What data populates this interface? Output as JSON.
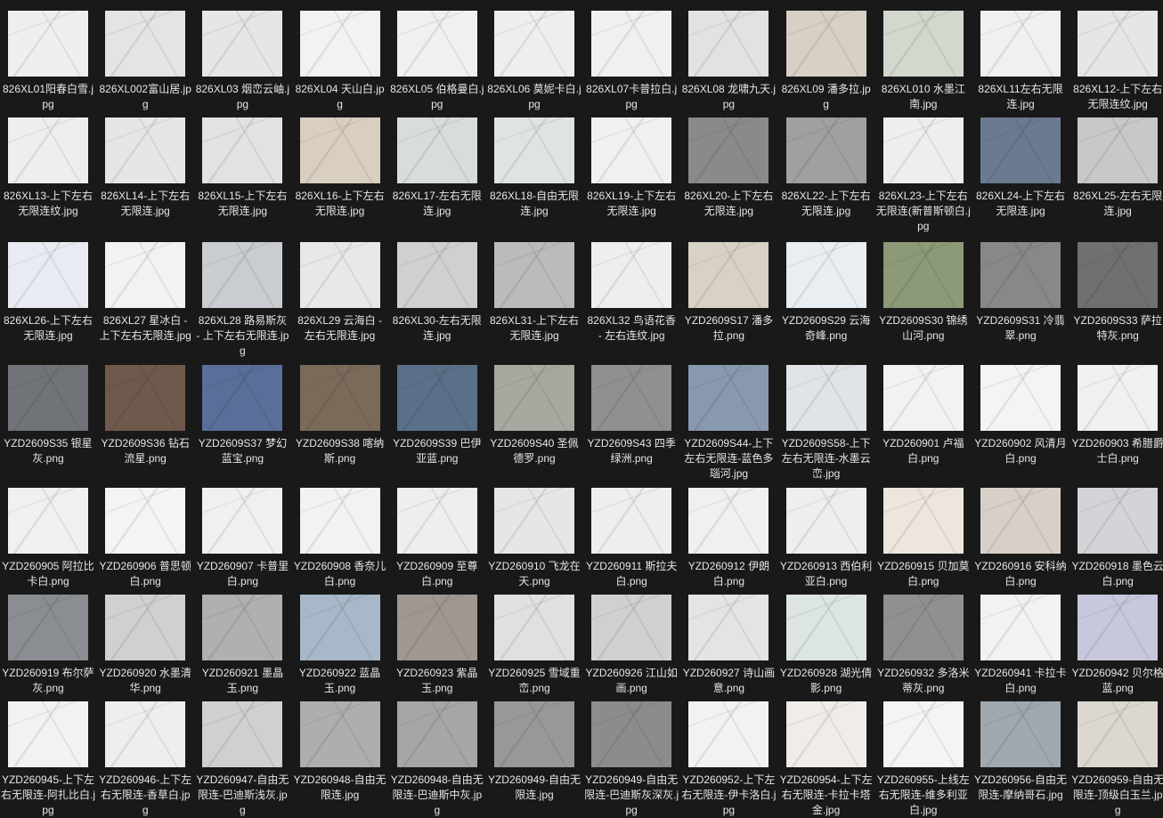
{
  "rows": [
    [
      {
        "name": "826XL01阳春白雪.jpg",
        "tone": "#efefef"
      },
      {
        "name": "826XL002富山居.jpg",
        "tone": "#e4e4e4"
      },
      {
        "name": "826XL03  烟峦云岫.jpg",
        "tone": "#e8e6e4"
      },
      {
        "name": "826XL04 天山白.jpg",
        "tone": "#f2f2f2"
      },
      {
        "name": "826XL05 伯格曼白.jpg",
        "tone": "#f0f0f0"
      },
      {
        "name": "826XL06 莫妮卡白.jpg",
        "tone": "#eeeeee"
      },
      {
        "name": "826XL07卡普拉白.jpg",
        "tone": "#f0f0f0"
      },
      {
        "name": "826XL08 龙啸九天.jpg",
        "tone": "#e2e2e2"
      },
      {
        "name": "826XL09 潘多拉.jpg",
        "tone": "#d8d0c4"
      },
      {
        "name": "826XL010 水墨江南.jpg",
        "tone": "#d2d8ce"
      },
      {
        "name": "826XL11左右无限连.jpg",
        "tone": "#f0f0f0"
      },
      {
        "name": "826XL12-上下左右无限连纹.jpg",
        "tone": "#e6e6e6"
      }
    ],
    [
      {
        "name": "826XL13-上下左右无限连纹.jpg",
        "tone": "#eeeeee"
      },
      {
        "name": "826XL14-上下左右无限连.jpg",
        "tone": "#e6e6e6"
      },
      {
        "name": "826XL15-上下左右无限连.jpg",
        "tone": "#e2e2e2"
      },
      {
        "name": "826XL16-上下左右无限连.jpg",
        "tone": "#d9cfc0"
      },
      {
        "name": "826XL17-左右无限连.jpg",
        "tone": "#d8dcdc"
      },
      {
        "name": "826XL18-自由无限连.jpg",
        "tone": "#dfe3e3"
      },
      {
        "name": "826XL19-上下左右无限连.jpg",
        "tone": "#f0f0f0"
      },
      {
        "name": "826XL20-上下左右无限连.jpg",
        "tone": "#8a8a8a"
      },
      {
        "name": "826XL22-上下左右无限连.jpg",
        "tone": "#a0a0a0"
      },
      {
        "name": "826XL23-上下左右无限连(新普斯顿白.jpg",
        "tone": "#eeeeee"
      },
      {
        "name": "826XL24-上下左右无限连.jpg",
        "tone": "#6a7a90"
      },
      {
        "name": "826XL25-左右无限连.jpg",
        "tone": "#c8c8c8"
      }
    ],
    [
      {
        "name": "826XL26-上下左右无限连.jpg",
        "tone": "#e8ecf2"
      },
      {
        "name": "826XL27 星冰白 - 上下左右无限连.jpg",
        "tone": "#f0f2f4"
      },
      {
        "name": "826XL28 路易斯灰 - 上下左右无限连.jpg",
        "tone": "#c9ccd0"
      },
      {
        "name": "826XL29 云海白 - 左右无限连.jpg",
        "tone": "#e8e8e8"
      },
      {
        "name": "826XL30-左右无限连.jpg",
        "tone": "#d0d0d0"
      },
      {
        "name": "826XL31-上下左右无限连.jpg",
        "tone": "#bbbbbb"
      },
      {
        "name": "826XL32 鸟语花香 - 左右连纹.jpg",
        "tone": "#eeeeee"
      },
      {
        "name": "YZD2609S17 潘多拉.png",
        "tone": "#d8d2c4"
      },
      {
        "name": "YZD2609S29 云海奇峰.png",
        "tone": "#e8eef2"
      },
      {
        "name": "YZD2609S30 锦绣山河.png",
        "tone": "#8c9a78"
      },
      {
        "name": "YZD2609S31 冷翡翠.png",
        "tone": "#888888"
      },
      {
        "name": "YZD2609S33 萨拉特灰.png",
        "tone": "#707070"
      }
    ],
    [
      {
        "name": "YZD2609S35 银星灰.png",
        "tone": "#707478"
      },
      {
        "name": "YZD2609S36 钻石流星.png",
        "tone": "#6e5a4c"
      },
      {
        "name": "YZD2609S37 梦幻蓝宝.png",
        "tone": "#5a6e9a"
      },
      {
        "name": "YZD2609S38 喀纳斯.png",
        "tone": "#7a6a5a"
      },
      {
        "name": "YZD2609S39 巴伊亚蓝.png",
        "tone": "#5a7088"
      },
      {
        "name": "YZD2609S40 圣佩德罗.png",
        "tone": "#a8a8a0"
      },
      {
        "name": "YZD2609S43 四季绿洲.png",
        "tone": "#909090"
      },
      {
        "name": "YZD2609S44-上下左右无限连-蓝色多瑙河.jpg",
        "tone": "#8898b0"
      },
      {
        "name": "YZD2609S58-上下左右无限连-水墨云峦.jpg",
        "tone": "#e0e4e8"
      },
      {
        "name": "YZD260901 卢福白.png",
        "tone": "#f2f2f2"
      },
      {
        "name": "YZD260902 风清月白.png",
        "tone": "#f4f4f4"
      },
      {
        "name": "YZD260903 希腊爵士白.png",
        "tone": "#f0f0f0"
      }
    ],
    [
      {
        "name": "YZD260905 阿拉比卡白.png",
        "tone": "#f0f0f0"
      },
      {
        "name": "YZD260906 普思顿白.png",
        "tone": "#f4f4f4"
      },
      {
        "name": "YZD260907 卡普里白.png",
        "tone": "#f0f0f0"
      },
      {
        "name": "YZD260908 香奈儿白.png",
        "tone": "#f2f2f2"
      },
      {
        "name": "YZD260909 至尊白.png",
        "tone": "#eeeeee"
      },
      {
        "name": "YZD260910 飞龙在天.png",
        "tone": "#e6e6e6"
      },
      {
        "name": "YZD260911 斯拉夫白.png",
        "tone": "#eeeeee"
      },
      {
        "name": "YZD260912 伊朗白.png",
        "tone": "#f0f0f0"
      },
      {
        "name": "YZD260913 西伯利亚白.png",
        "tone": "#eeeeee"
      },
      {
        "name": "YZD260915 贝加莫白.png",
        "tone": "#ece6de"
      },
      {
        "name": "YZD260916 安科纳白.png",
        "tone": "#d8d0c8"
      },
      {
        "name": "YZD260918 墨色云白.png",
        "tone": "#d4d4d8"
      }
    ],
    [
      {
        "name": "YZD260919 布尔萨灰.png",
        "tone": "#8a8e92"
      },
      {
        "name": "YZD260920 水墨清华.png",
        "tone": "#d0d0d0"
      },
      {
        "name": "YZD260921 墨晶玉.png",
        "tone": "#b0b0b0"
      },
      {
        "name": "YZD260922  蓝晶玉.png",
        "tone": "#a8b8c8"
      },
      {
        "name": "YZD260923  紫晶玉.png",
        "tone": "#a09890"
      },
      {
        "name": "YZD260925  雪域重峦.png",
        "tone": "#e0e0e0"
      },
      {
        "name": "YZD260926 江山如画.png",
        "tone": "#d0d0d0"
      },
      {
        "name": "YZD260927 诗山画意.png",
        "tone": "#e4e4e4"
      },
      {
        "name": "YZD260928 湖光倩影.png",
        "tone": "#dde4e4"
      },
      {
        "name": "YZD260932 多洛米蒂灰.png",
        "tone": "#909090"
      },
      {
        "name": "YZD260941 卡拉卡白.png",
        "tone": "#f2f2f2"
      },
      {
        "name": "YZD260942 贝尔格蓝.png",
        "tone": "#c8c8dc"
      }
    ],
    [
      {
        "name": "YZD260945-上下左右无限连-阿扎比白.jpg",
        "tone": "#f2f2f2"
      },
      {
        "name": "YZD260946-上下左右无限连-香草白.jpg",
        "tone": "#eeeeee"
      },
      {
        "name": "YZD260947-自由无限连-巴迪斯浅灰.jpg",
        "tone": "#d0d0d0"
      },
      {
        "name": "YZD260948-自由无限连.jpg",
        "tone": "#b0aeac"
      },
      {
        "name": "YZD260948-自由无限连-巴迪斯中灰.jpg",
        "tone": "#a8a6a4"
      },
      {
        "name": "YZD260949-自由无限连.jpg",
        "tone": "#9a9896"
      },
      {
        "name": "YZD260949-自由无限连-巴迪斯灰深灰.jpg",
        "tone": "#8e8c8a"
      },
      {
        "name": "YZD260952-上下左右无限连-伊卡洛白.jpg",
        "tone": "#f2f2f2"
      },
      {
        "name": "YZD260954-上下左右无限连-卡拉卡塔金.jpg",
        "tone": "#f0ede8"
      },
      {
        "name": "YZD260955-上线左右无限连-维多利亚白.jpg",
        "tone": "#f4f4f4"
      },
      {
        "name": "YZD260956-自由无限连-摩纳哥石.jpg",
        "tone": "#a0a8b0"
      },
      {
        "name": "YZD260959-自由无限连-顶级白玉兰.jpg",
        "tone": "#dcd8d0"
      }
    ]
  ]
}
